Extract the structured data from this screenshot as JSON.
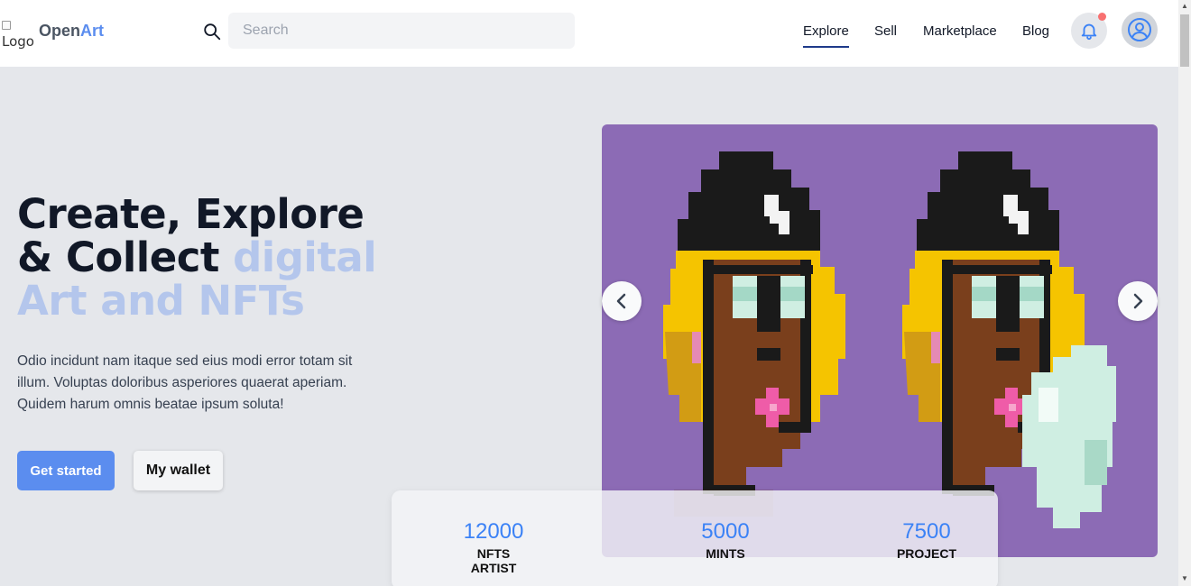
{
  "header": {
    "logo_alt": "Logo",
    "brand_part1": "Open",
    "brand_part2": "Art",
    "search_placeholder": "Search",
    "nav": [
      {
        "label": "Explore",
        "active": true
      },
      {
        "label": "Sell"
      },
      {
        "label": "Marketplace"
      },
      {
        "label": "Blog"
      }
    ],
    "icons": {
      "search": "search-icon",
      "notifications": "bell-icon",
      "profile": "user-circle-icon"
    }
  },
  "hero": {
    "title_dark": "Create, Explore & Collect",
    "title_accent": "digital Art and NFTs",
    "description": "Odio incidunt nam itaque sed eius modi error totam sit illum. Voluptas doloribus asperiores quaerat aperiam. Quidem harum omnis beatae ipsum soluta!",
    "primary_button": "Get started",
    "secondary_button": "My wallet"
  },
  "carousel": {
    "prev_icon": "chevron-left-icon",
    "next_icon": "chevron-right-icon"
  },
  "stats": [
    {
      "value": "12000",
      "label": "NFTS ARTIST"
    },
    {
      "value": "5000",
      "label": "MINTS"
    },
    {
      "value": "7500",
      "label": "PROJECT"
    }
  ],
  "colors": {
    "accent": "#5b8def",
    "accent_light": "#b4c6ec",
    "stat_number": "#3b82f6",
    "carousel_bg": "#8c6bb5",
    "page_bg": "#e5e7eb",
    "notification_dot": "#f87171"
  }
}
